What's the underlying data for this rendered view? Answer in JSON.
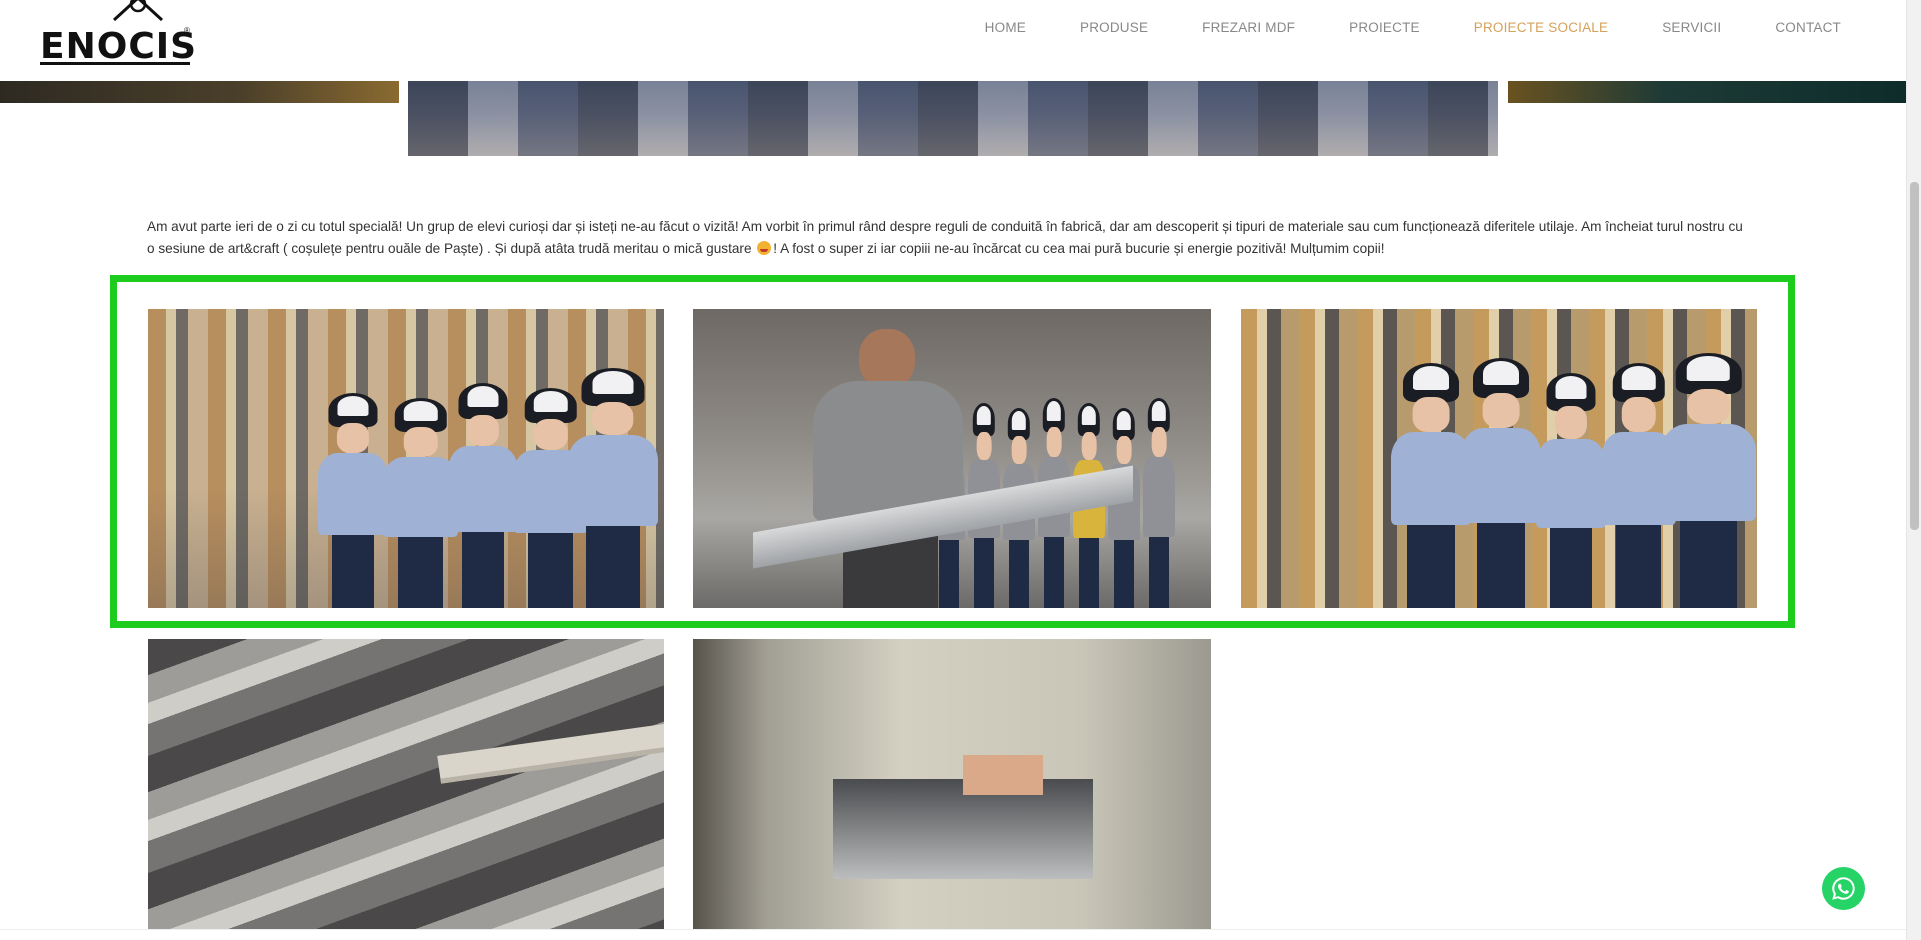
{
  "header": {
    "logo_text": "ENOCIS",
    "logo_mark": "®",
    "nav": [
      {
        "label": "HOME",
        "active": false
      },
      {
        "label": "PRODUSE",
        "active": false
      },
      {
        "label": "FREZARI MDF",
        "active": false
      },
      {
        "label": "PROIECTE",
        "active": false
      },
      {
        "label": "PROIECTE SOCIALE",
        "active": true
      },
      {
        "label": "SERVICII",
        "active": false
      },
      {
        "label": "CONTACT",
        "active": false
      }
    ]
  },
  "content": {
    "intro_part1": "Am avut parte ieri de o zi cu totul specială! Un grup de elevi curioși dar și isteți ne-au făcut o vizită! Am vorbit în primul rând despre reguli de conduită în fabrică, dar am descoperit și tipuri de materiale sau cum funcționează diferitele utilaje. Am încheiat turul nostru cu o sesiune de art&craft ( coșulețe pentru ouăle de Paște) . Și după atâta trudă meritau o mică gustare",
    "intro_part2": "! A fost o super zi iar copiii ne-au încărcat cu cea mai pură bucurie și energie pozitivă! Mulțumim copii!"
  },
  "colors": {
    "nav_active": "#d4a25a",
    "nav_default": "#888888",
    "highlight": "#1ecc1e",
    "whatsapp": "#25d366"
  },
  "icons": {
    "whatsapp": "whatsapp-icon",
    "emoji": "heart-eyes-emoji-icon"
  }
}
